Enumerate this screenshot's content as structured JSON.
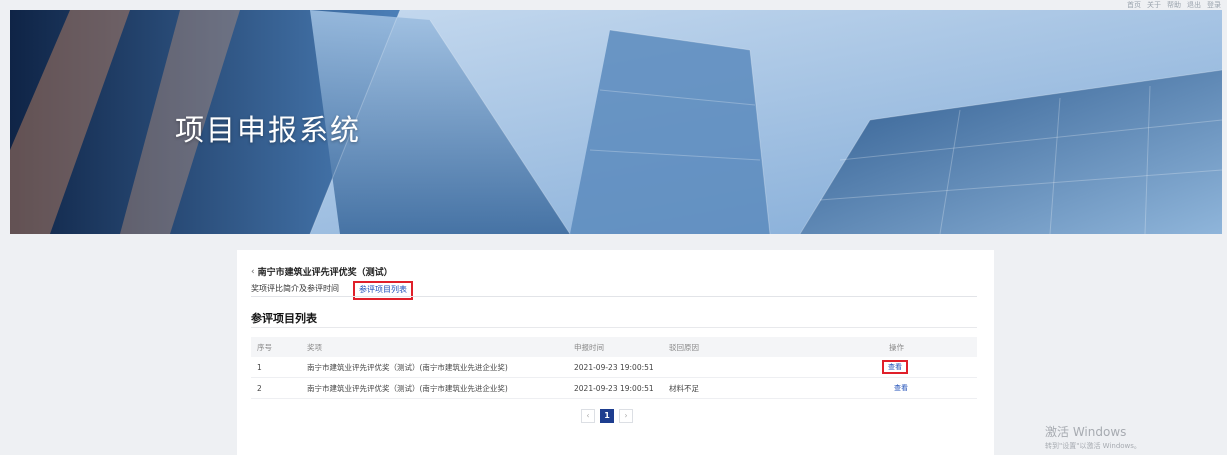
{
  "topnav": [
    "首页",
    "关于",
    "帮助",
    "退出",
    "登录"
  ],
  "banner": {
    "title": "项目申报系统"
  },
  "card": {
    "back_title": "南宁市建筑业评先评优奖（测试）",
    "tabs": [
      "奖项评比简介及参评时间",
      "参评项目列表"
    ],
    "section_title": "参评项目列表",
    "table": {
      "headers": [
        "序号",
        "奖项",
        "申报时间",
        "驳回原因",
        "操作"
      ],
      "rows": [
        {
          "index": "1",
          "award": "南宁市建筑业评先评优奖（测试）(南宁市建筑业先进企业奖)",
          "time": "2021-09-23 19:00:51",
          "reason": "",
          "action": "查看"
        },
        {
          "index": "2",
          "award": "南宁市建筑业评先评优奖（测试）(南宁市建筑业先进企业奖)",
          "time": "2021-09-23 19:00:51",
          "reason": "材料不足",
          "action": "查看"
        }
      ]
    },
    "pagination": {
      "prev": "‹",
      "current": "1",
      "next": "›"
    }
  },
  "watermark": {
    "line1": "激活 Windows",
    "line2": "转到\"设置\"以激活 Windows。"
  },
  "colors": {
    "accent": "#1f4fb8",
    "highlight": "#e0202a",
    "page_active": "#1d3d8f"
  }
}
